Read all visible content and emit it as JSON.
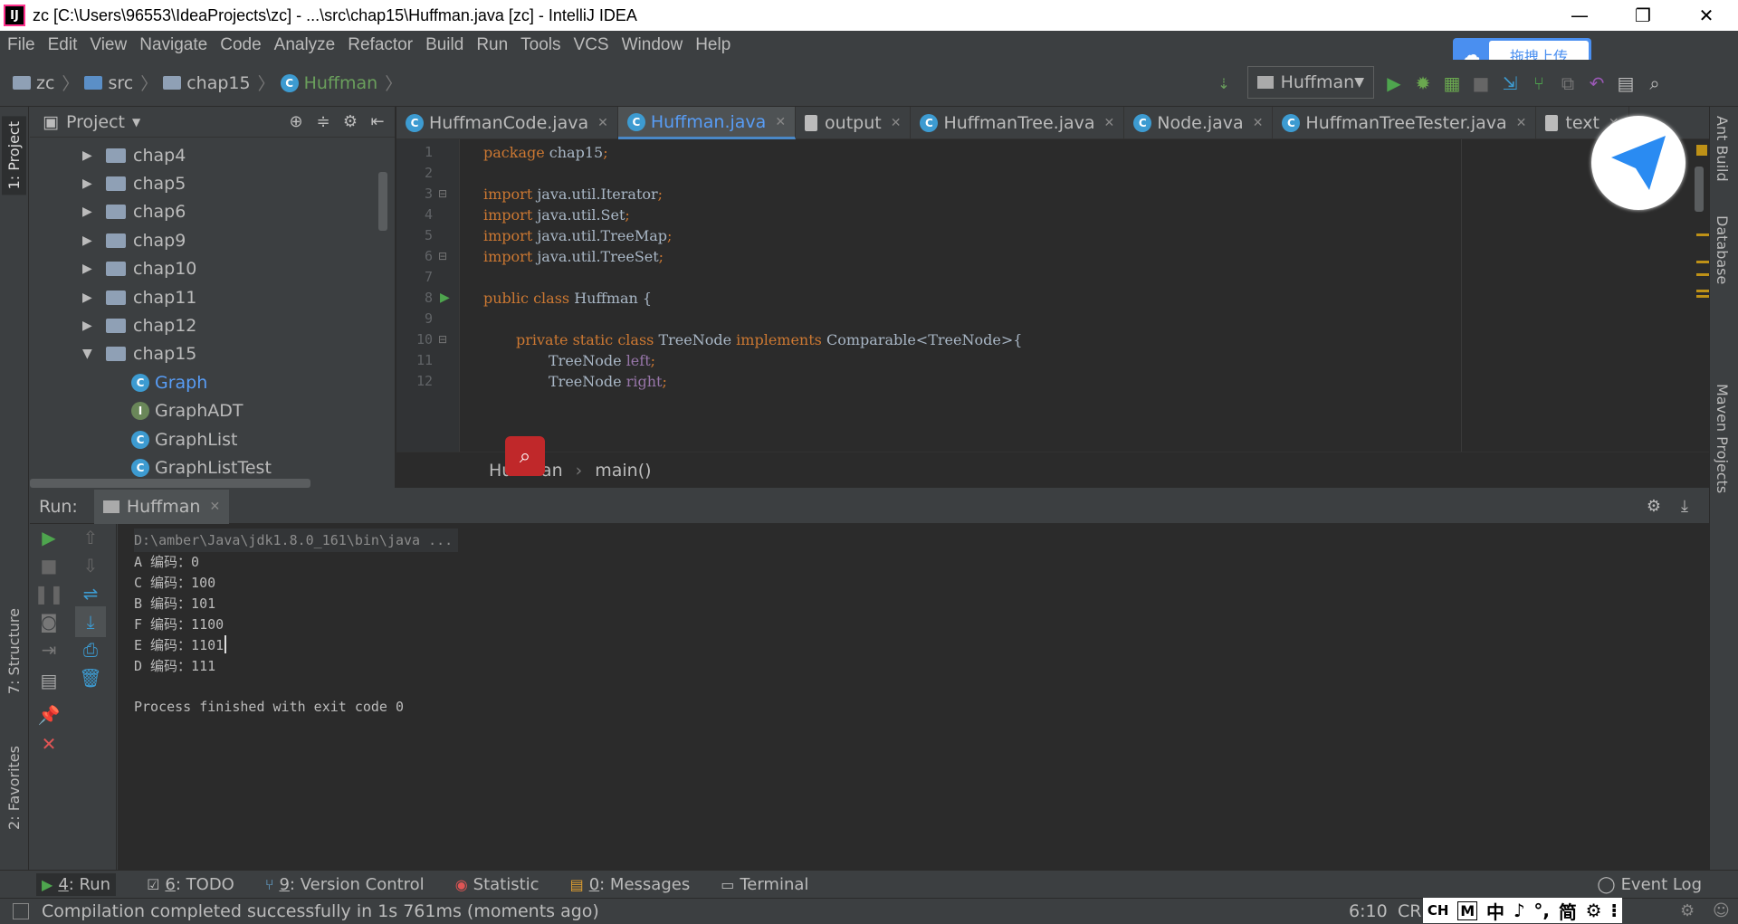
{
  "window": {
    "title": "zc [C:\\Users\\96553\\IdeaProjects\\zc] - ...\\src\\chap15\\Huffman.java [zc] - IntelliJ IDEA",
    "logo": "IJ",
    "minimize": "—",
    "restore": "❐",
    "close": "✕"
  },
  "menu": [
    "File",
    "Edit",
    "View",
    "Navigate",
    "Code",
    "Analyze",
    "Refactor",
    "Build",
    "Run",
    "Tools",
    "VCS",
    "Window",
    "Help"
  ],
  "baidu": {
    "label": "拖拽上传"
  },
  "breadcrumb": [
    "zc",
    "src",
    "chap15",
    "Huffman"
  ],
  "run_config": "Huffman",
  "project": {
    "title": "Project",
    "items": [
      {
        "label": "chap4",
        "type": "folder",
        "expanded": false
      },
      {
        "label": "chap5",
        "type": "folder",
        "expanded": false
      },
      {
        "label": "chap6",
        "type": "folder",
        "expanded": false
      },
      {
        "label": "chap9",
        "type": "folder",
        "expanded": false
      },
      {
        "label": "chap10",
        "type": "folder",
        "expanded": false
      },
      {
        "label": "chap11",
        "type": "folder",
        "expanded": false
      },
      {
        "label": "chap12",
        "type": "folder",
        "expanded": false
      },
      {
        "label": "chap15",
        "type": "folder",
        "expanded": true
      },
      {
        "label": "Graph",
        "type": "class",
        "selected": true
      },
      {
        "label": "GraphADT",
        "type": "interface"
      },
      {
        "label": "GraphList",
        "type": "class"
      },
      {
        "label": "GraphListTest",
        "type": "class"
      }
    ]
  },
  "tabs": [
    {
      "label": "HuffmanCode.java",
      "icon": "class-icon"
    },
    {
      "label": "Huffman.java",
      "icon": "class-icon",
      "active": true
    },
    {
      "label": "output",
      "icon": "file-icon"
    },
    {
      "label": "HuffmanTree.java",
      "icon": "class-icon"
    },
    {
      "label": "Node.java",
      "icon": "class-icon"
    },
    {
      "label": "HuffmanTreeTester.java",
      "icon": "class-icon"
    },
    {
      "label": "text",
      "icon": "file-icon"
    }
  ],
  "code": {
    "line_numbers": [
      "1",
      "2",
      "3",
      "4",
      "5",
      "6",
      "7",
      "8",
      "9",
      "10",
      "11",
      "12"
    ],
    "l1_kw": "package",
    "l1_rest": " chap15",
    "l3_kw": "import",
    "l3_rest": " java.util.Iterator",
    "l4_kw": "import",
    "l4_rest": " java.util.Set",
    "l5_kw": "import",
    "l5_rest": " java.util.TreeMap",
    "l6_kw": "import",
    "l6_rest": " java.util.TreeSet",
    "l8_kw": "public class",
    "l8_rest": " Huffman {",
    "l10_kw1": "private static class",
    "l10_mid": " TreeNode ",
    "l10_kw2": "implements",
    "l10_rest": " Comparable<TreeNode>{",
    "l11_type": "TreeNode ",
    "l11_field": "left",
    "l12_type": "TreeNode ",
    "l12_field": "right",
    "semicolon": ";"
  },
  "editor_breadcrumb": [
    "Huffman",
    "main()"
  ],
  "side_tabs_left": [
    "1: Project",
    "7: Structure",
    "2: Favorites"
  ],
  "side_tabs_right": [
    "Ant Build",
    "Database",
    "Maven Projects"
  ],
  "run": {
    "label": "Run:",
    "tab": "Huffman",
    "output": [
      "D:\\amber\\Java\\jdk1.8.0_161\\bin\\java ...",
      "A 编码：0",
      "C 编码：100",
      "B 编码：101",
      "F 编码：1100",
      "E 编码：1101",
      "D 编码：111",
      "",
      "Process finished with exit code 0"
    ]
  },
  "bottom_tabs": [
    {
      "num": "4",
      "label": ": Run",
      "icon": "▶"
    },
    {
      "num": "6",
      "label": ": TODO",
      "icon": "☑"
    },
    {
      "num": "9",
      "label": ": Version Control",
      "icon": "⑂"
    },
    {
      "num": "",
      "label": "Statistic",
      "icon": "◉"
    },
    {
      "num": "0",
      "label": ": Messages",
      "icon": "▤"
    },
    {
      "num": "",
      "label": "Terminal",
      "icon": "▭"
    }
  ],
  "event_log": "Event Log",
  "status": {
    "message": "Compilation completed successfully in 1s 761ms (moments ago)",
    "position": "6:10",
    "line_sep": "CR"
  },
  "ime": [
    "CH",
    "M",
    "中",
    "♪",
    "°,",
    "简",
    "⚙",
    "⁝"
  ]
}
